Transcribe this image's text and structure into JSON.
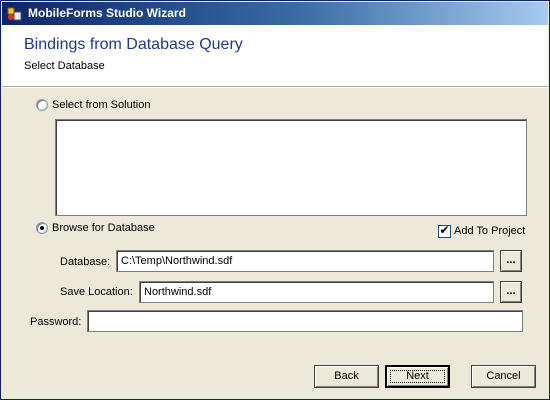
{
  "window": {
    "title": "MobileForms Studio Wizard"
  },
  "header": {
    "title": "Bindings from Database Query",
    "subtitle": "Select Database"
  },
  "options": {
    "solution": {
      "label": "Select from Solution",
      "selected": false
    },
    "browse": {
      "label": "Browse for Database",
      "selected": true
    }
  },
  "add_to_project": {
    "label": "Add To Project",
    "checked": true
  },
  "fields": {
    "database": {
      "label": "Database:",
      "value": "C:\\Temp\\Northwind.sdf",
      "browse_label": "..."
    },
    "save_location": {
      "label": "Save Location:",
      "value": "Northwind.sdf",
      "browse_label": "..."
    },
    "password": {
      "label": "Password:",
      "value": ""
    }
  },
  "buttons": {
    "back": "Back",
    "next": "Next",
    "cancel": "Cancel"
  }
}
